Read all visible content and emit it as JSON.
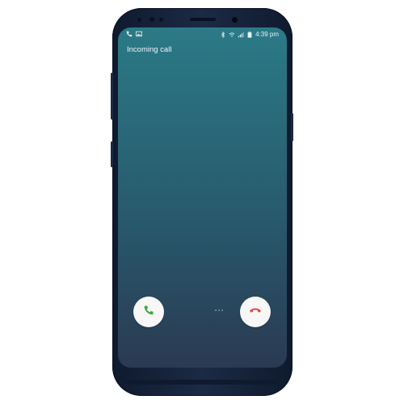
{
  "status_bar": {
    "time": "4:39 pm",
    "left_icons": [
      "phone-icon",
      "image-icon"
    ],
    "right_icons": [
      "bluetooth-icon",
      "wifi-icon",
      "signal-icon",
      "battery-icon"
    ]
  },
  "screen": {
    "incoming_label": "Incoming call"
  },
  "buttons": {
    "answer": {
      "icon": "phone-answer-icon",
      "color": "#3aa83a"
    },
    "decline": {
      "icon": "phone-decline-icon",
      "color": "#e2483f"
    }
  },
  "colors": {
    "screen_top": "#2b7a87",
    "screen_bottom": "#2a3a52",
    "phone_body": "#1b2a45"
  }
}
